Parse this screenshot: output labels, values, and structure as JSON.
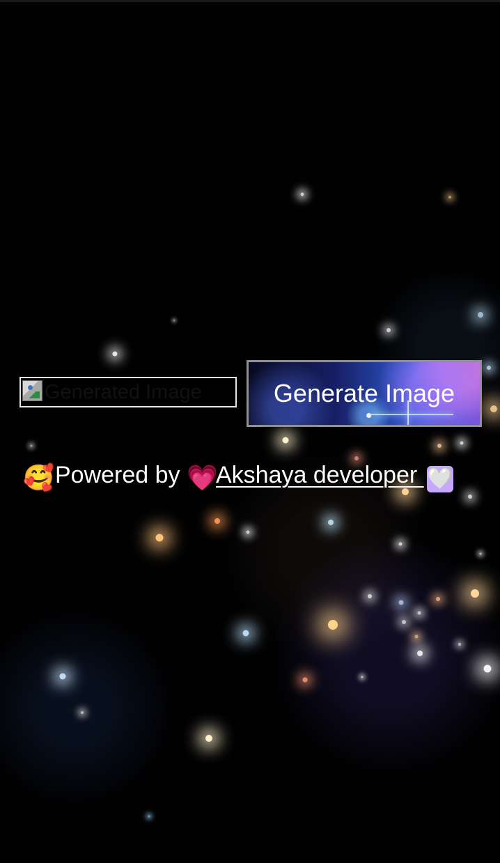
{
  "page": {
    "image_alt": "Generated Image",
    "generate_button": "Generate Image",
    "footer": {
      "prefix_emoji": "🥰",
      "powered_text": "Powered by ",
      "link_heart": "💗",
      "developer_text": "Akshaya developer ",
      "end_heart": "🤍"
    }
  },
  "colors": {
    "background": "#000000",
    "text": "#ffffff",
    "button_border": "#8f8f94",
    "link": "#ffffff"
  },
  "icons": {
    "broken_image": "broken-image-icon",
    "face": "smiling-face-with-hearts-icon",
    "pink_heart": "growing-heart-icon",
    "white_heart": "white-heart-icon"
  }
}
